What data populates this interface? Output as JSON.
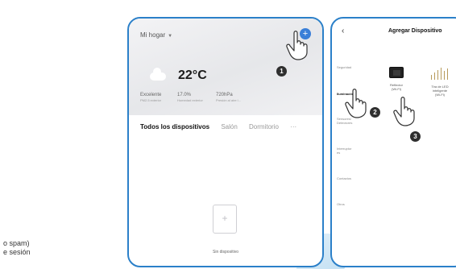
{
  "left_text": {
    "line1": "o spam)",
    "line2": "e sesión"
  },
  "home": {
    "selector": "Mi hogar",
    "add_icon": "plus",
    "temperature": "22°C",
    "stats": [
      {
        "value": "Excelente",
        "label": "PM2.5 exterior"
      },
      {
        "value": "17.0%",
        "label": "Humedad exterior"
      },
      {
        "value": "720hPa",
        "label": "Presión al aire l..."
      }
    ],
    "tabs": [
      "Todos los dispositivos",
      "Salón",
      "Dormitorio",
      "···"
    ],
    "empty_text": "Sin dispositivo"
  },
  "add_device": {
    "back_icon": "chevron-left",
    "title": "Agregar Dispositivo",
    "categories": [
      "Seguridad",
      "Iluminación",
      "Sensores/\nDetectores",
      "Interruptor\nes",
      "Contactos",
      "Otros"
    ],
    "active_category_index": 1,
    "products": [
      {
        "name": "Reflector\n(Wi-Fi)",
        "icon": "floodlight-icon"
      },
      {
        "name": "Tira de LED\ninteligente\n(Wi-Fi)",
        "icon": "led-strip-icon"
      }
    ]
  },
  "steps": [
    "1",
    "2",
    "3"
  ]
}
